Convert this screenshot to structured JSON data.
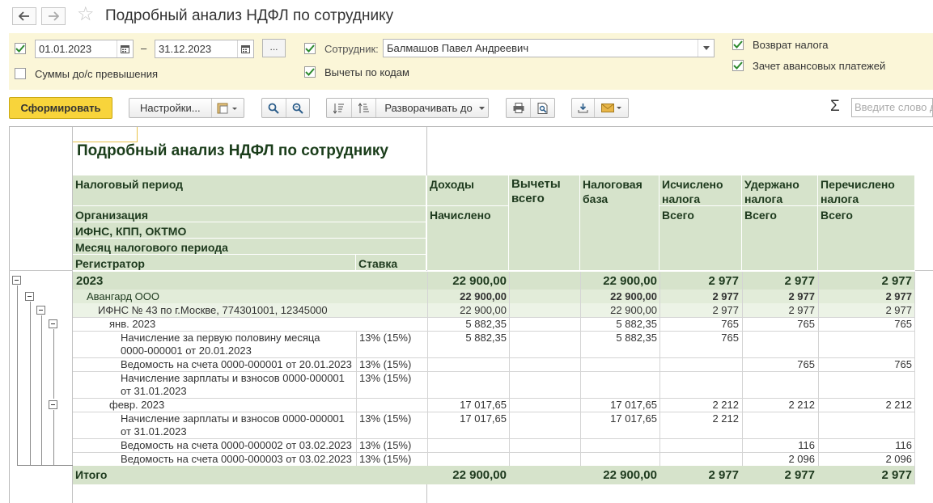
{
  "window": {
    "title": "Подробный анализ НДФЛ по сотруднику"
  },
  "params": {
    "date_from": "01.01.2023",
    "date_dash": "–",
    "date_to": "31.12.2023",
    "dots": "...",
    "employee_label": "Сотрудник:",
    "employee_value": "Балмашов Павел Андреевич",
    "sums_over_label": "Суммы до/с превышения",
    "deductions_by_code_label": "Вычеты по кодам",
    "tax_refund_label": "Возврат налога",
    "advance_offset_label": "Зачет авансовых платежей"
  },
  "toolbar": {
    "generate": "Сформировать",
    "settings": "Настройки...",
    "expand": "Разворачивать до",
    "sigma": "Σ",
    "search_placeholder": "Введите слово д"
  },
  "report": {
    "title": "Подробный анализ НДФЛ по сотруднику",
    "headers": {
      "tax_period": "Налоговый период",
      "organization": "Организация",
      "ifns": "ИФНС, КПП, ОКТМО",
      "month": "Месяц налогового периода",
      "registrar": "Регистратор",
      "rate": "Ставка",
      "income": "Доходы",
      "accrued": "Начислено",
      "deductions_l1": "Вычеты",
      "deductions_l2": "всего",
      "base_l1": "Налоговая",
      "base_l2": "база",
      "calc_l1": "Исчислено",
      "calc_l2": "налога",
      "calc_sub": "Всего",
      "withheld_l1": "Удержано",
      "withheld_l2": "налога",
      "withheld_sub": "Всего",
      "transferred_l1": "Перечислено",
      "transferred_l2": "налога",
      "transferred_sub": "Всего"
    },
    "rows": {
      "year": {
        "label": "2023",
        "income": "22 900,00",
        "base": "22 900,00",
        "calc": "2 977",
        "withheld": "2 977",
        "transferred": "2 977"
      },
      "org": {
        "label": "Авангард ООО",
        "income": "22 900,00",
        "base": "22 900,00",
        "calc": "2 977",
        "withheld": "2 977",
        "transferred": "2 977"
      },
      "ifns": {
        "label": "ИФНС № 43 по г.Москве, 774301001, 12345000",
        "income": "22 900,00",
        "base": "22 900,00",
        "calc": "2 977",
        "withheld": "2 977",
        "transferred": "2 977"
      },
      "jan": {
        "label": "янв. 2023",
        "income": "5 882,35",
        "base": "5 882,35",
        "calc": "765",
        "withheld": "765",
        "transferred": "765"
      },
      "jan_doc1": {
        "line1": "Начисление за первую половину месяца",
        "line2": "0000-000001 от 20.01.2023",
        "rate": "13% (15%)",
        "income": "5 882,35",
        "base": "5 882,35",
        "calc": "765"
      },
      "jan_doc2": {
        "line1": "Ведомость на счета 0000-000001 от 20.01.2023",
        "rate": "13% (15%)",
        "withheld": "765",
        "transferred": "765"
      },
      "jan_doc3": {
        "line1": "Начисление зарплаты и взносов 0000-000001",
        "line2": "от 31.01.2023",
        "rate": "13% (15%)"
      },
      "feb": {
        "label": "февр. 2023",
        "income": "17 017,65",
        "base": "17 017,65",
        "calc": "2 212",
        "withheld": "2 212",
        "transferred": "2 212"
      },
      "feb_doc1": {
        "line1": "Начисление зарплаты и взносов 0000-000001",
        "line2": "от 31.01.2023",
        "rate": "13% (15%)",
        "income": "17 017,65",
        "base": "17 017,65",
        "calc": "2 212"
      },
      "feb_doc2": {
        "line1": "Ведомость на счета 0000-000002 от 03.02.2023",
        "rate": "13% (15%)",
        "withheld": "116",
        "transferred": "116"
      },
      "feb_doc3": {
        "line1": "Ведомость на счета 0000-000003 от 03.02.2023",
        "rate": "13% (15%)",
        "withheld": "2 096",
        "transferred": "2 096"
      },
      "total": {
        "label": "Итого",
        "income": "22 900,00",
        "base": "22 900,00",
        "calc": "2 977",
        "withheld": "2 977",
        "transferred": "2 977"
      }
    }
  },
  "colors": {
    "header_green": "#d6e3cb",
    "row_green": "#e9f1e2",
    "params_bg": "#fbf6d8",
    "primary_yellow": "#f8d43b"
  }
}
